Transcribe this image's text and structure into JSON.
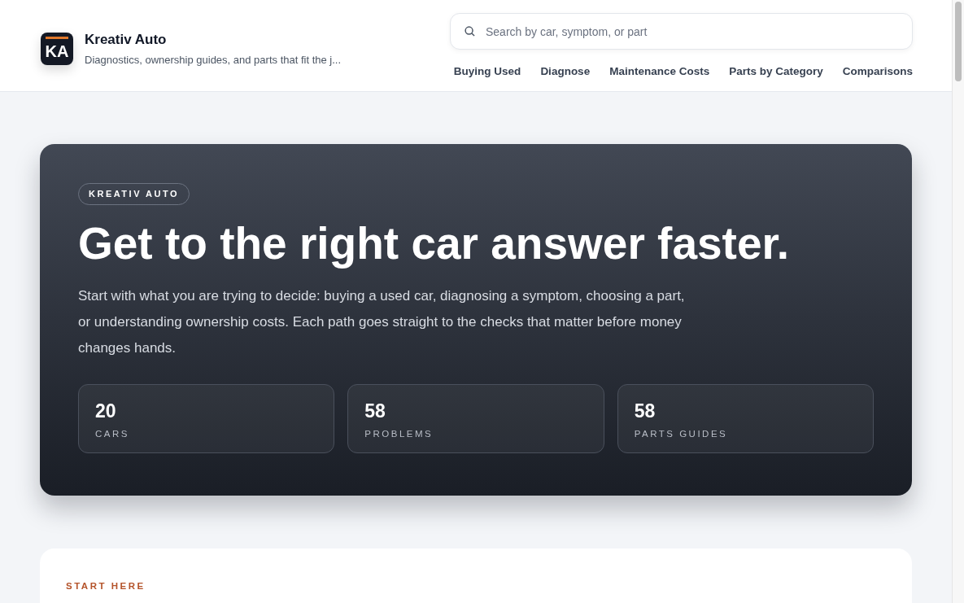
{
  "brand": {
    "logo": "KA",
    "name": "Kreativ Auto",
    "tagline": "Diagnostics, ownership guides, and parts that fit the j..."
  },
  "search": {
    "placeholder": "Search by car, symptom, or part"
  },
  "nav": [
    "Buying Used",
    "Diagnose",
    "Maintenance Costs",
    "Parts by Category",
    "Comparisons"
  ],
  "hero": {
    "eyebrow": "KREATIV AUTO",
    "title": "Get to the right car answer faster.",
    "description": "Start with what you are trying to decide: buying a used car, diagnosing a symptom, choosing a part, or understanding ownership costs. Each path goes straight to the checks that matter before money changes hands.",
    "stats": [
      {
        "value": "20",
        "label": "CARS"
      },
      {
        "value": "58",
        "label": "PROBLEMS"
      },
      {
        "value": "58",
        "label": "PARTS GUIDES"
      }
    ]
  },
  "section": {
    "eyebrow": "START HERE"
  }
}
